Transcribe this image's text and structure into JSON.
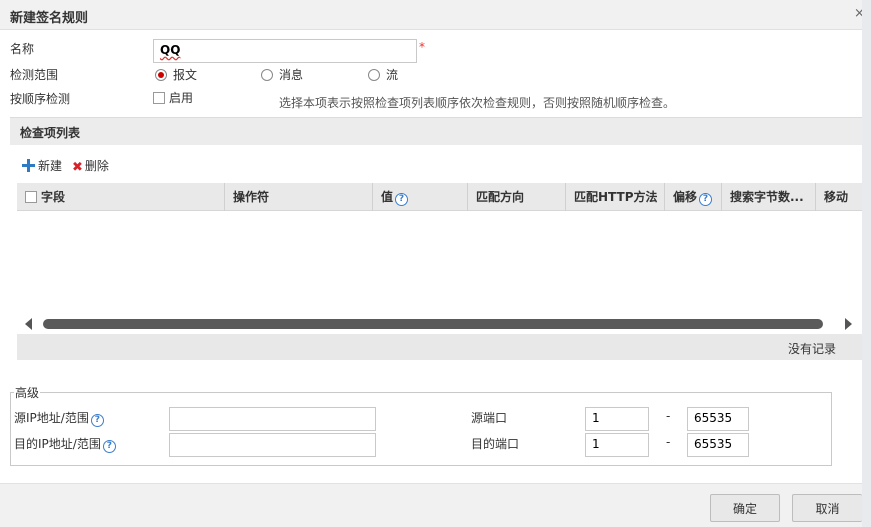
{
  "dialog": {
    "title": "新建签名规则",
    "close_label": "×"
  },
  "form": {
    "name_label": "名称",
    "name_value": "QQ",
    "required_mark": "*",
    "scope_label": "检测范围",
    "scope_options": [
      "报文",
      "消息",
      "流"
    ],
    "scope_selected": "报文",
    "order_label": "按顺序检测",
    "order_checkbox_label": "启用",
    "order_hint": "选择本项表示按照检查项列表顺序依次检查规则，否则按照随机顺序检查。"
  },
  "check_list": {
    "section_title": "检查项列表",
    "add_label": "新建",
    "delete_label": "删除",
    "columns": [
      "字段",
      "操作符",
      "值",
      "匹配方向",
      "匹配HTTP方法",
      "偏移",
      "搜索字节数...",
      "移动"
    ],
    "help_symbol": "?",
    "rows": [],
    "empty_text": "没有记录"
  },
  "advanced": {
    "legend": "高级",
    "src_ip_label": "源IP地址/范围",
    "src_ip_value": "",
    "dst_ip_label": "目的IP地址/范围",
    "dst_ip_value": "",
    "src_port_label": "源端口",
    "src_port_from": "1",
    "src_port_to": "65535",
    "dst_port_label": "目的端口",
    "dst_port_from": "1",
    "dst_port_to": "65535",
    "range_dash": "-"
  },
  "footer": {
    "ok_label": "确定",
    "cancel_label": "取消"
  },
  "colors": {
    "required": "#e33333",
    "radio_selected": "#cc0000",
    "help_icon": "#3a7ed0",
    "add_icon": "#2e7bc4",
    "delete_icon": "#d8222a"
  }
}
